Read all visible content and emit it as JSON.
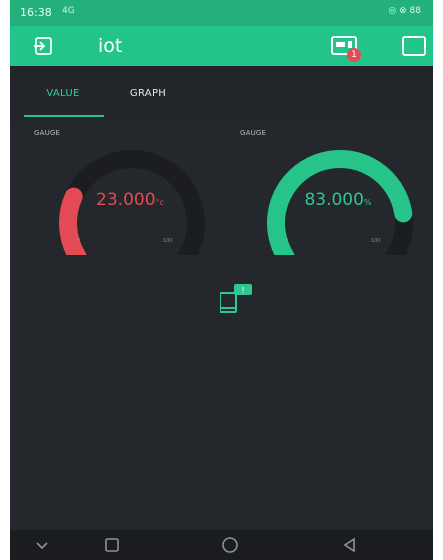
{
  "status": {
    "time": "16:38",
    "signal": "4G",
    "right_icons": "◎ ⊗ 88"
  },
  "app": {
    "title": "iot",
    "notification_count": "1"
  },
  "tabs": [
    {
      "label": "VALUE",
      "active": true
    },
    {
      "label": "GRAPH",
      "active": false
    }
  ],
  "widgets": [
    {
      "label": "GAUGE",
      "value": "23.000",
      "unit": "°c",
      "min": "0",
      "max": "100",
      "level": 0.23,
      "color": "#e44b54"
    },
    {
      "label": "GAUGE",
      "value": "83.000",
      "unit": "%",
      "min": "0",
      "max": "100",
      "level": 0.83,
      "color": "#27c489"
    }
  ],
  "colors": {
    "accent": "#23c489",
    "bg": "#24272b",
    "red": "#e44b54"
  },
  "icons": [
    "back-icon",
    "device-icon",
    "square-icon",
    "device-notification-icon",
    "nav-back-icon",
    "nav-home-icon",
    "nav-recents-icon"
  ]
}
